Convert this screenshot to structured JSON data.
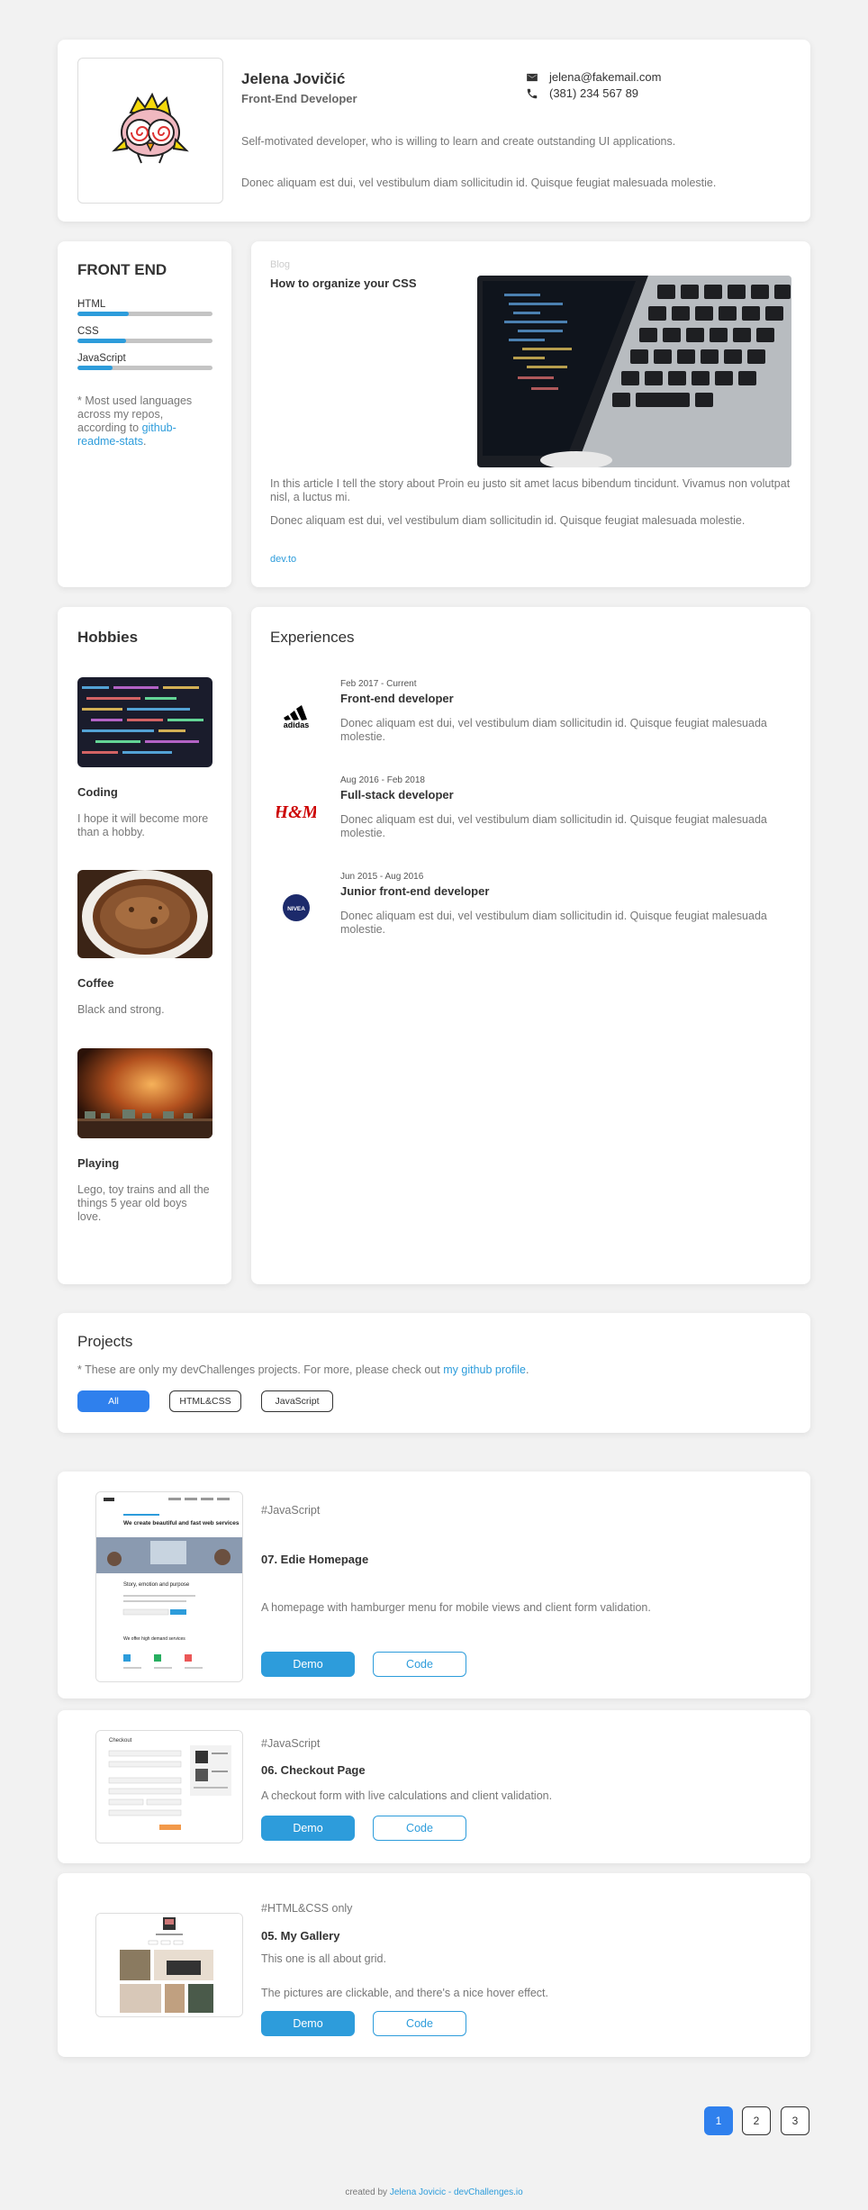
{
  "profile": {
    "name": "Jelena Jovičić",
    "role": "Front-End Developer",
    "email": "jelena@fakemail.com",
    "phone": "(381) 234 567 89",
    "bio": "Self-motivated developer, who is willing to learn and create outstanding UI applications.",
    "bio2": "Donec aliquam est dui, vel vestibulum diam sollicitudin id. Quisque feugiat malesuada molestie."
  },
  "skills": {
    "title": "FRONT END",
    "items": [
      {
        "label": "HTML",
        "level": 0.38
      },
      {
        "label": "CSS",
        "level": 0.36
      },
      {
        "label": "JavaScript",
        "level": 0.26
      }
    ],
    "note_prefix": "* Most used languages across my repos, according to ",
    "note_link": "github-readme-stats",
    "note_suffix": "."
  },
  "blog": {
    "tag": "Blog",
    "title": "How to organize your CSS",
    "p1": "In this article I tell the story about Proin eu justo sit amet lacus bibendum tincidunt. Vivamus non volutpat nisl, a luctus mi.",
    "p2": "Donec aliquam est dui, vel vestibulum diam sollicitudin id. Quisque feugiat malesuada molestie.",
    "link": "dev.to"
  },
  "hobbies": {
    "title": "Hobbies",
    "items": [
      {
        "name": "Coding",
        "desc": "I hope it will become more than a hobby."
      },
      {
        "name": "Coffee",
        "desc": "Black and strong."
      },
      {
        "name": "Playing",
        "desc": "Lego, toy trains and all the things 5 year old boys love."
      }
    ]
  },
  "experiences": {
    "title": "Experiences",
    "items": [
      {
        "date": "Feb 2017 - Current",
        "role": "Front-end developer",
        "desc": "Donec aliquam est dui, vel vestibulum diam sollicitudin id. Quisque feugiat malesuada molestie.",
        "logo": "adidas"
      },
      {
        "date": "Aug 2016 - Feb 2018",
        "role": "Full-stack developer",
        "desc": "Donec aliquam est dui, vel vestibulum diam sollicitudin id. Quisque feugiat malesuada molestie.",
        "logo": "H&M"
      },
      {
        "date": "Jun 2015 - Aug 2016",
        "role": "Junior front-end developer",
        "desc": "Donec aliquam est dui, vel vestibulum diam sollicitudin id. Quisque feugiat malesuada molestie.",
        "logo": "NIVEA"
      }
    ]
  },
  "projects": {
    "title": "Projects",
    "note_prefix": "* These are only my devChallenges projects. For more, please check out ",
    "note_link": "my github profile",
    "note_suffix": ".",
    "filters": [
      "All",
      "HTML&CSS",
      "JavaScript"
    ],
    "items": [
      {
        "tag": "#JavaScript",
        "name": "07. Edie Homepage",
        "desc": "A homepage with hamburger menu for mobile views and client form validation.",
        "demo": "Demo",
        "code": "Code",
        "thumb": {
          "heading": "We create beautiful and fast web services",
          "sub": "Story, emotion and purpose",
          "footer": "We offer high demand services"
        }
      },
      {
        "tag": "#JavaScript",
        "name": "06. Checkout Page",
        "desc": "A checkout form with live calculations and client validation.",
        "demo": "Demo",
        "code": "Code",
        "thumb": {
          "heading": "Checkout"
        }
      },
      {
        "tag": "#HTML&CSS only",
        "name": "05. My Gallery",
        "desc": "This one is all about grid.",
        "desc2": "The pictures are clickable, and there's a nice hover effect.",
        "demo": "Demo",
        "code": "Code"
      }
    ]
  },
  "pagination": {
    "pages": [
      "1",
      "2",
      "3"
    ],
    "active": 0
  },
  "footer": {
    "prefix": "created by ",
    "link": "Jelena Jovicic - devChallenges.io"
  },
  "colors": {
    "accent": "#2d9cdb",
    "active": "#2f80ed",
    "background": "#f2f2f2"
  }
}
